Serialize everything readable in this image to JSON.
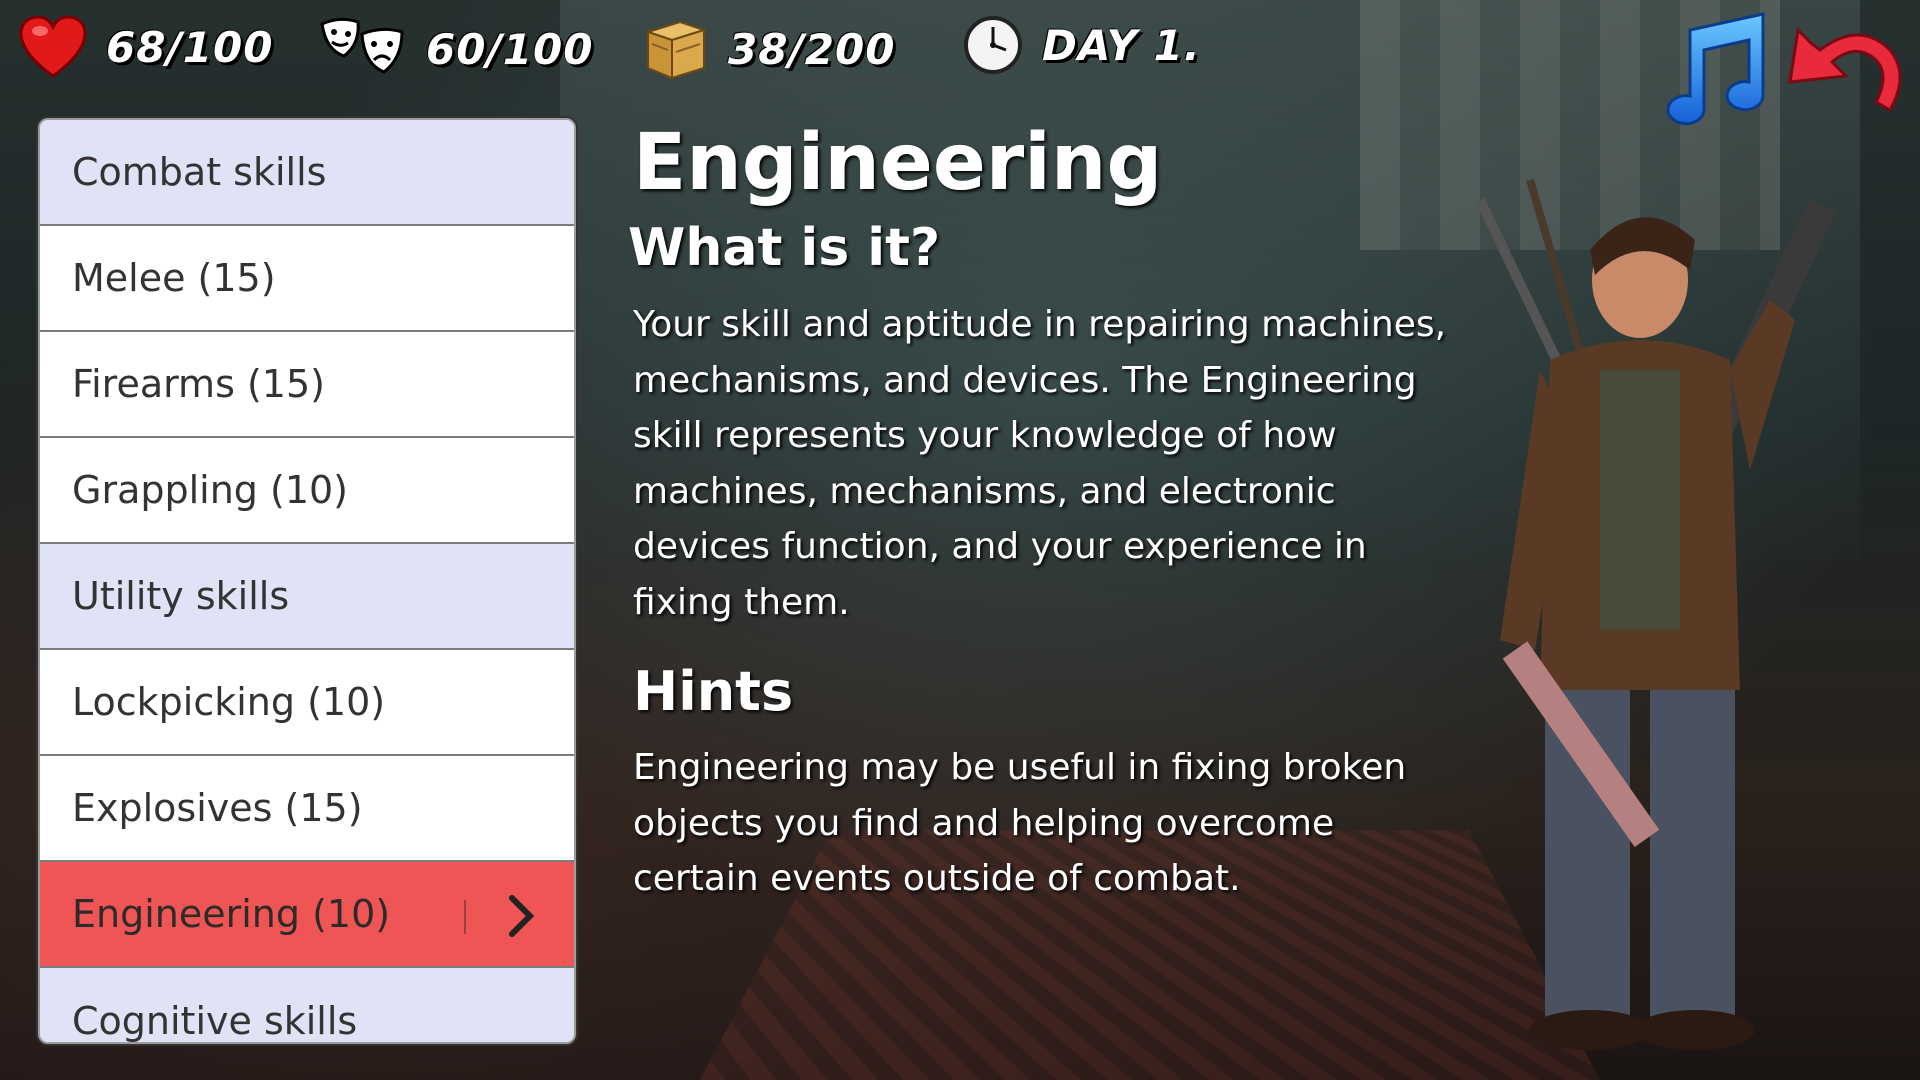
{
  "hud": {
    "health": {
      "icon": "heart-icon",
      "value": "68/100"
    },
    "morale": {
      "icon": "masks-icon",
      "value": "60/100"
    },
    "supplies": {
      "icon": "crate-icon",
      "value": "38/200"
    },
    "day": {
      "icon": "clock-icon",
      "value": "DAY 1."
    }
  },
  "buttons": {
    "music": "music-note-icon",
    "back": "back-arrow-icon"
  },
  "skills_list": [
    {
      "label": "Combat skills",
      "kind": "header"
    },
    {
      "label": "Melee (15)",
      "kind": "item"
    },
    {
      "label": "Firearms (15)",
      "kind": "item"
    },
    {
      "label": "Grappling (10)",
      "kind": "item"
    },
    {
      "label": "Utility skills",
      "kind": "header"
    },
    {
      "label": "Lockpicking (10)",
      "kind": "item"
    },
    {
      "label": "Explosives (15)",
      "kind": "item"
    },
    {
      "label": "Engineering (10)",
      "kind": "selected"
    },
    {
      "label": "Cognitive skills",
      "kind": "header"
    }
  ],
  "detail": {
    "title": "Engineering",
    "what_heading": "What is it?",
    "what_text": "Your skill and aptitude in repairing machines, mechanisms, and devices.  The Engineering skill represents your knowledge of how machines, mechanisms, and electronic devices function, and your experience in fixing them.",
    "hints_heading": "Hints",
    "hints_text": "Engineering may be useful in fixing broken objects you find and helping overcome certain events outside of combat."
  },
  "colors": {
    "selected_row": "#f05555",
    "header_row": "#e0e2f6",
    "item_row": "#ffffff",
    "music_icon": "#1e7ef0",
    "back_icon": "#e82a3c"
  }
}
